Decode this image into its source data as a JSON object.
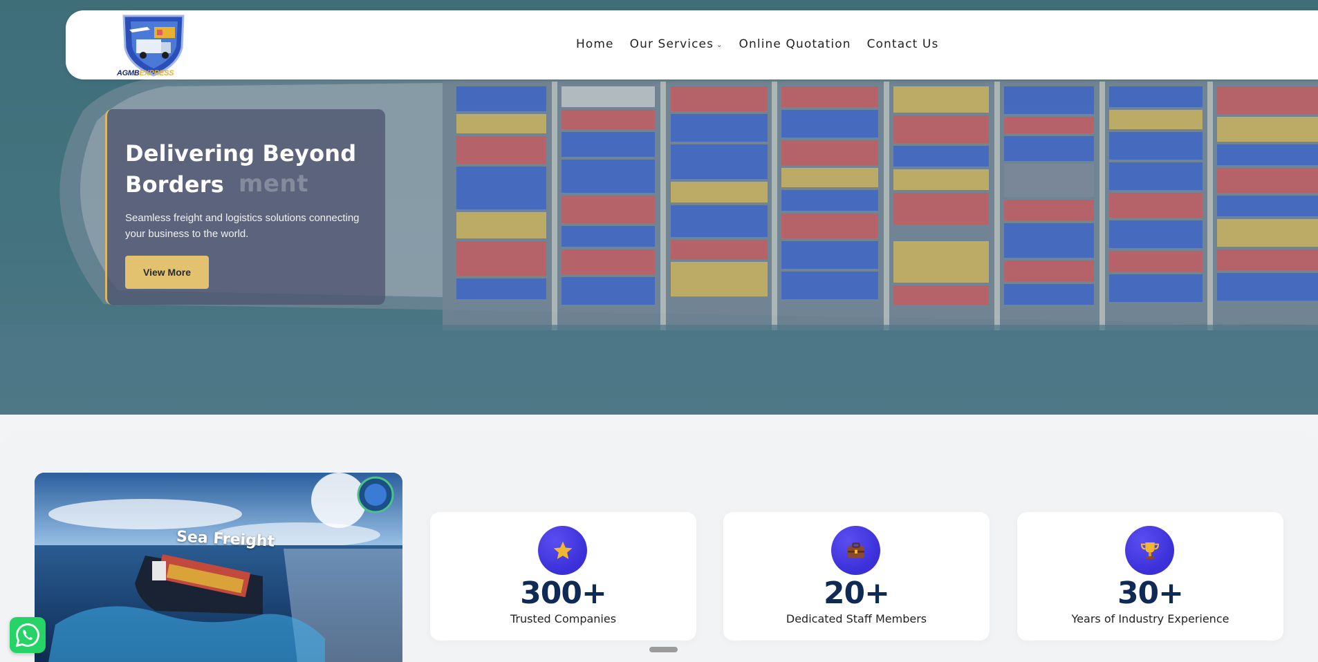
{
  "nav": {
    "logo_text_a": "AGMB",
    "logo_text_b": "EXPRESS",
    "items": [
      "Home",
      "Our Services",
      "Online Quotation",
      "Contact Us"
    ]
  },
  "hero": {
    "ghost_text": "ment",
    "title": "Delivering Beyond Borders",
    "subtitle": "Seamless freight and logistics solutions connecting your business to the world.",
    "button_label": "View More"
  },
  "video": {
    "caption": "Sea Freight"
  },
  "stats": [
    {
      "icon": "star-icon",
      "value": "300+",
      "label": "Trusted Companies"
    },
    {
      "icon": "briefcase-icon",
      "value": "20+",
      "label": "Dedicated Staff Members"
    },
    {
      "icon": "trophy-icon",
      "value": "30+",
      "label": "Years of Industry Experience"
    }
  ],
  "colors": {
    "accent_gold": "#e3c26f",
    "stat_icon_bg": "#3a2fd8",
    "stat_value": "#0f2a55",
    "whatsapp": "#25d366"
  }
}
